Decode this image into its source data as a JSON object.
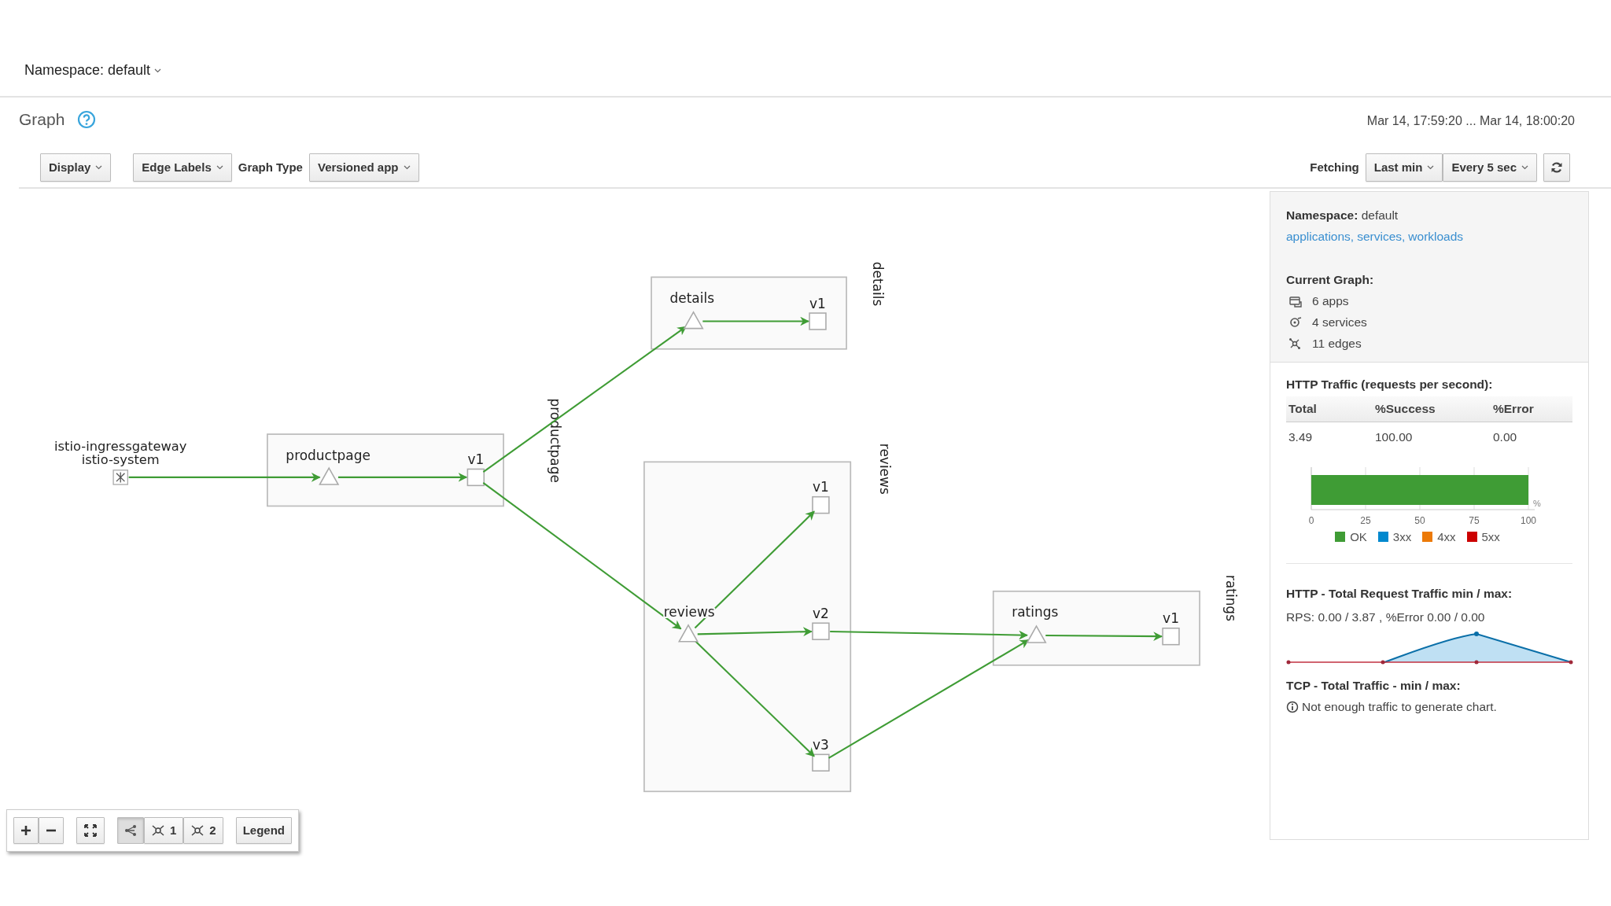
{
  "namespace_selector": {
    "label": "Namespace: default"
  },
  "page": {
    "title": "Graph",
    "time_range": "Mar 14, 17:59:20 ... Mar 14, 18:00:20"
  },
  "toolbar": {
    "left": [
      {
        "kind": "dropdown",
        "label": "Display"
      },
      {
        "kind": "dropdown",
        "label": "Edge Labels"
      },
      {
        "kind": "label",
        "label": "Graph Type"
      },
      {
        "kind": "dropdown",
        "label": "Versioned app"
      }
    ],
    "fetching_label": "Fetching",
    "duration": "Last min",
    "refresh_interval": "Every 5 sec"
  },
  "graph": {
    "gateway": {
      "name": "istio-ingressgateway",
      "namespace": "istio-system"
    },
    "apps": [
      {
        "box_label": "productpage",
        "app": "productpage",
        "versions": [
          "v1"
        ]
      },
      {
        "box_label": "details",
        "app": "details",
        "versions": [
          "v1"
        ]
      },
      {
        "box_label": "reviews",
        "app": "reviews",
        "versions": [
          "v1",
          "v2",
          "v3"
        ]
      },
      {
        "box_label": "ratings",
        "app": "ratings",
        "versions": [
          "v1"
        ]
      }
    ]
  },
  "graph_controls": [
    {
      "kind": "zoom-in"
    },
    {
      "kind": "zoom-out"
    },
    {
      "kind": "fit"
    },
    {
      "kind": "layout",
      "selected": true
    },
    {
      "kind": "layout",
      "label": "1",
      "selected": false
    },
    {
      "kind": "layout",
      "label": "2",
      "selected": false
    },
    {
      "kind": "legend",
      "label": "Legend"
    }
  ],
  "side_panel": {
    "summary": {
      "namespace_label": "Namespace:",
      "namespace": "default",
      "links": [
        "applications,",
        "services,",
        "workloads"
      ],
      "current_graph_title": "Current Graph:",
      "counts": [
        {
          "kind": "apps",
          "text": "6 apps"
        },
        {
          "kind": "services",
          "text": "4 services"
        },
        {
          "kind": "edges",
          "text": "11 edges"
        }
      ]
    },
    "http_traffic": {
      "title": "HTTP Traffic (requests per second):",
      "columns": [
        "Total",
        "%Success",
        "%Error"
      ],
      "row": [
        "3.49",
        "100.00",
        "0.00"
      ],
      "chart_data": {
        "type": "bar",
        "orientation": "horizontal",
        "stacked": true,
        "grid": true,
        "xlabel": "%",
        "xlim": [
          0,
          100
        ],
        "xticks": [
          0,
          25,
          50,
          75,
          100
        ],
        "series": [
          {
            "name": "OK",
            "color": "#3f9c35",
            "values": [
              100
            ]
          },
          {
            "name": "3xx",
            "color": "#0088ce",
            "values": [
              0
            ]
          },
          {
            "name": "4xx",
            "color": "#ec7a08",
            "values": [
              0
            ]
          },
          {
            "name": "5xx",
            "color": "#cc0000",
            "values": [
              0
            ]
          }
        ]
      }
    },
    "request_traffic": {
      "title": "HTTP - Total Request Traffic min / max:",
      "summary": "RPS: 0.00 / 3.87 , %Error 0.00 / 0.00"
    },
    "tcp_traffic": {
      "title": "TCP - Total Traffic - min / max:",
      "message": "Not enough traffic to generate chart."
    }
  }
}
